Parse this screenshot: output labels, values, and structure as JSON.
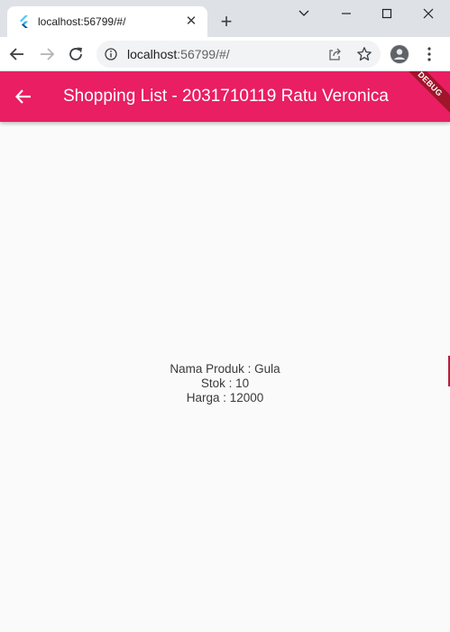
{
  "browser": {
    "tab": {
      "title": "localhost:56799/#/",
      "close_glyph": "✕"
    },
    "new_tab_glyph": "+",
    "address_bar": {
      "host": "localhost",
      "rest": ":56799/#/"
    },
    "icons": {
      "favicon": "flutter-icon",
      "back": "arrow-left-icon",
      "forward": "arrow-right-icon",
      "reload": "reload-icon",
      "info": "info-icon",
      "share": "share-icon",
      "bookmark": "star-icon",
      "profile": "account-icon",
      "menu": "kebab-menu-icon"
    }
  },
  "app": {
    "appbar": {
      "title": "Shopping List - 2031710119 Ratu Veronica",
      "color": "#e91e63"
    },
    "debug_banner": "DEBUG",
    "product": {
      "name_line": "Nama Produk : Gula",
      "stock_line": "Stok : 10",
      "price_line": "Harga : 12000"
    }
  }
}
